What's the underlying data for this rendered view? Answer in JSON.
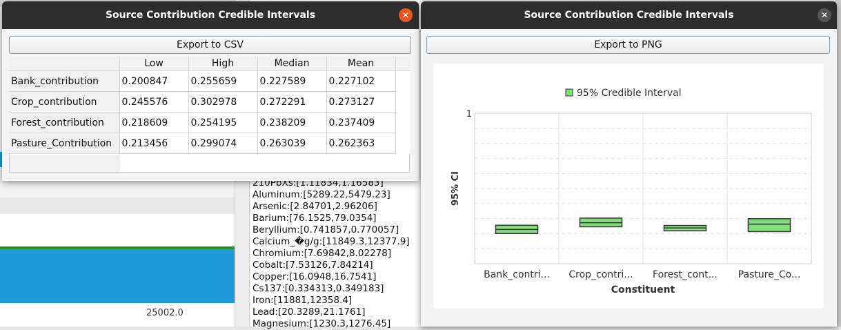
{
  "background": {
    "x_tick": "25002.0",
    "element_list": [
      "210PbXs:[1.11834,1.16583]",
      "Aluminum:[5289.22,5479.23]",
      "Arsenic:[2.84701,2.96206]",
      "Barium:[76.1525,79.0354]",
      "Beryllium:[0.741857,0.770057]",
      "Calcium_�g/g:[11849.3,12377.9]",
      "Chromium:[7.69842,8.02278]",
      "Cobalt:[7.53126,7.84214]",
      "Copper:[16.0948,16.7541]",
      "Cs137:[0.334313,0.349183]",
      "Iron:[11881,12358.4]",
      "Lead:[20.3289,21.1761]",
      "Magnesium:[1230.3,1276.45]"
    ]
  },
  "window_table": {
    "title": "Source Contribution Credible Intervals",
    "export_label": "Export to CSV",
    "columns": [
      "Low",
      "High",
      "Median",
      "Mean"
    ],
    "rows": [
      {
        "name": "Bank_contribution",
        "values": [
          "0.200847",
          "0.255659",
          "0.227589",
          "0.227102"
        ]
      },
      {
        "name": "Crop_contribution",
        "values": [
          "0.245576",
          "0.302978",
          "0.272291",
          "0.273127"
        ]
      },
      {
        "name": "Forest_contribution",
        "values": [
          "0.218609",
          "0.254195",
          "0.238209",
          "0.237409"
        ]
      },
      {
        "name": "Pasture_Contribution",
        "values": [
          "0.213456",
          "0.299074",
          "0.263039",
          "0.262363"
        ]
      }
    ]
  },
  "window_chart": {
    "title": "Source Contribution Credible Intervals",
    "export_label": "Export to PNG"
  },
  "colors": {
    "box_fill": "#7fe07a",
    "box_stroke": "#333333",
    "close_active": "#e95420"
  },
  "chart_data": {
    "type": "box",
    "legend": "95% Credible Interval",
    "legend_position": "top",
    "xlabel": "Constituent",
    "ylabel": "95% CI",
    "ylim": [
      0,
      1
    ],
    "y_tick_labels": [
      "1"
    ],
    "grid": true,
    "categories": [
      "Bank_contri...",
      "Crop_contri...",
      "Forest_cont...",
      "Pasture_Co..."
    ],
    "low": [
      0.200847,
      0.245576,
      0.218609,
      0.213456
    ],
    "high": [
      0.255659,
      0.302978,
      0.254195,
      0.299074
    ],
    "median": [
      0.227589,
      0.272291,
      0.238209,
      0.263039
    ]
  }
}
